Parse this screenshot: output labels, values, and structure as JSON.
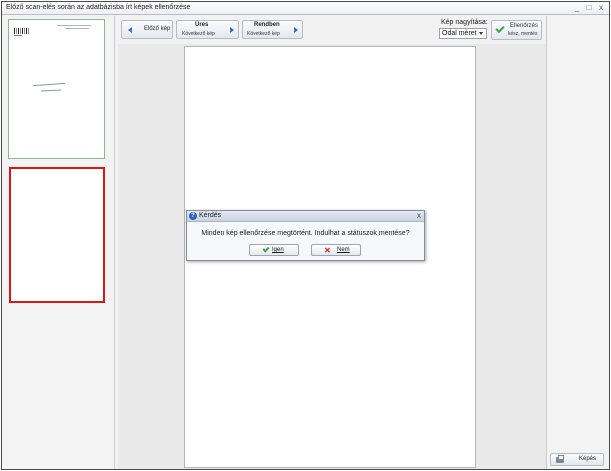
{
  "window": {
    "title": "Előző scan-elés során az adatbázisba írt képek ellenőrzése",
    "controls": [
      "_",
      "□",
      "x"
    ]
  },
  "toolbar": {
    "prev_label": "Előző kép",
    "empty_title": "Üres",
    "empty_sub": "Következő kép",
    "ok_title": "Rendben",
    "ok_sub": "Következő kép",
    "zoom_label": "Kép nagyítása:",
    "zoom_value": "Odal méret",
    "check_line1": "Ellenőrzés",
    "check_line2": "kész, mentés"
  },
  "right_panel": {
    "print_label": "Képés"
  },
  "dialog": {
    "title": "Kérdés",
    "close": "x",
    "message": "Minden kép ellenőrzése megtörtént. Indulhat a státuszok mentése?",
    "yes_label": "Igen",
    "no_label": "Nem"
  },
  "thumb1_handwriting": {
    "line1": "Kiképzést",
    "line2": "Sahna"
  },
  "colors": {
    "selected_border": "#e01616",
    "accent_blue": "#3a6bc0",
    "ok_green": "#3ea64a",
    "no_red": "#e0201b"
  }
}
